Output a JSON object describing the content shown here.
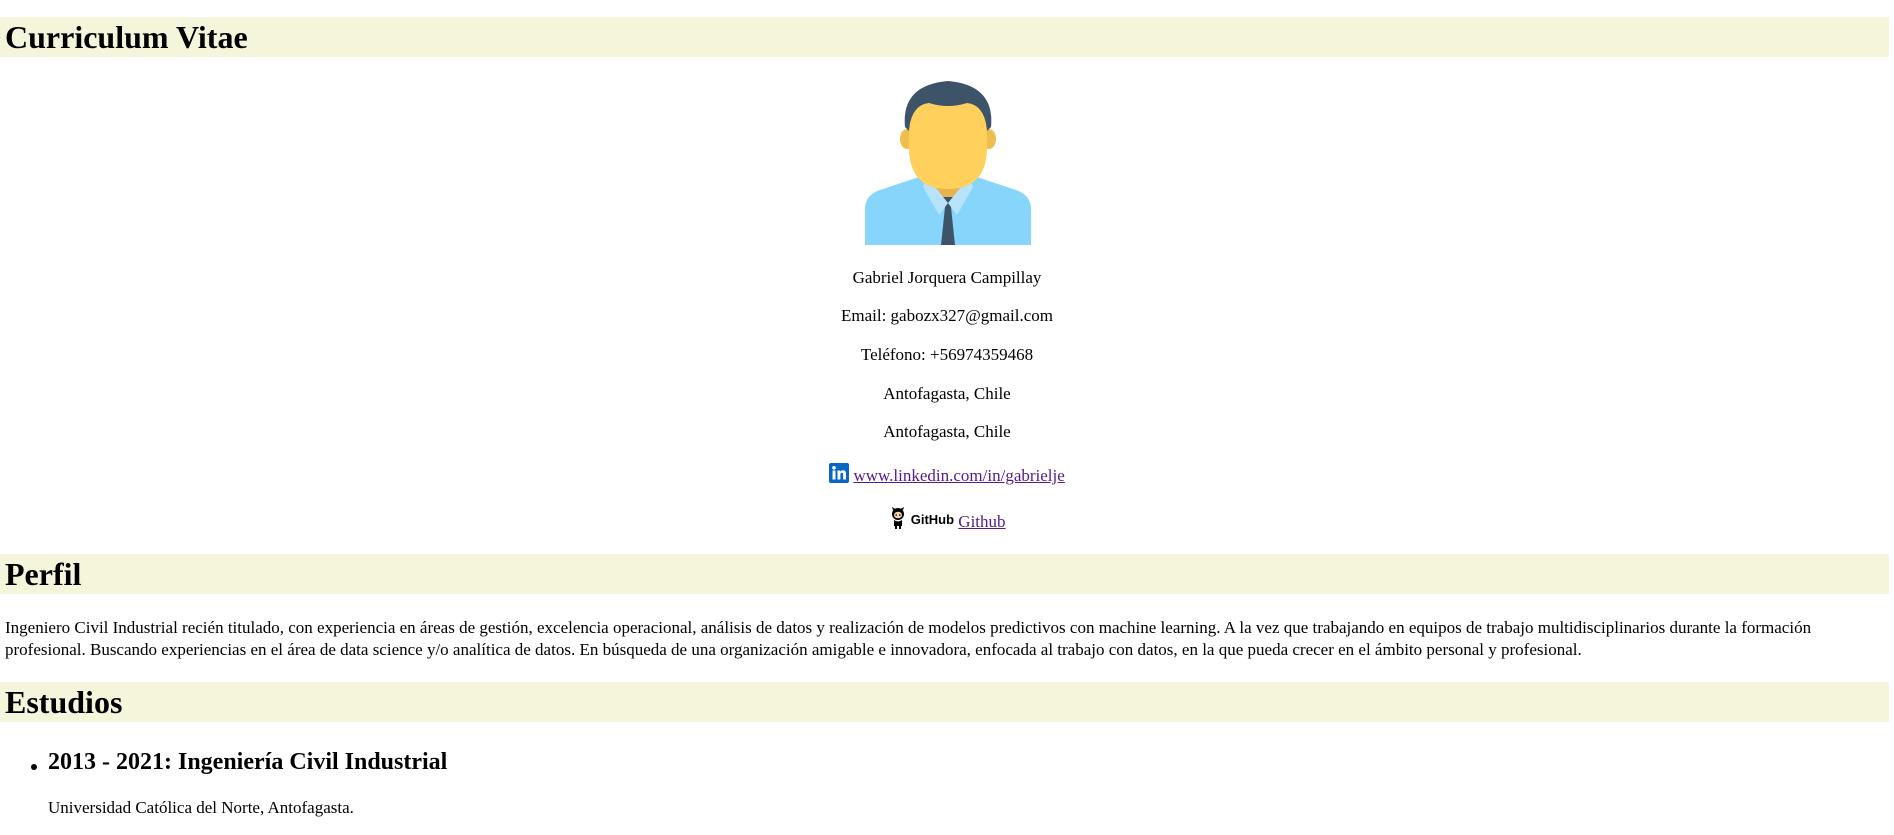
{
  "headings": {
    "cv": "Curriculum Vitae",
    "perfil": "Perfil",
    "estudios": "Estudios"
  },
  "contact": {
    "avatar_icon": "person-avatar-icon",
    "name": "Gabriel Jorquera Campillay",
    "email": "Email: gabozx327@gmail.com",
    "phone": "Teléfono: +56974359468",
    "city1": "Antofagasta, Chile",
    "city2": "Antofagasta, Chile",
    "linkedin_icon": "linkedin-icon",
    "linkedin_label": "www.linkedin.com/in/gabrielje",
    "github_icon": "github-icon",
    "github_logo_text": "GitHub",
    "github_label": "Github"
  },
  "profile": {
    "text": "Ingeniero Civil Industrial recién titulado, con experiencia en áreas de gestión, excelencia operacional, análisis de datos y realización de modelos predictivos con machine learning. A la vez que trabajando en equipos de trabajo multidisciplinarios durante la formación profesional. Buscando experiencias en el área de data science y/o analítica de datos. En búsqueda de una organización amigable e innovadora, enfocada al trabajo con datos, en la que pueda crecer en el ámbito personal y profesional."
  },
  "studies": [
    {
      "title": "2013 - 2021: Ingeniería Civil Industrial",
      "place": "Universidad Católica del Norte, Antofagasta."
    }
  ],
  "colors": {
    "heading_bg": "#f5f5dc",
    "link": "#551a8b",
    "linkedin": "#0a66c2"
  }
}
